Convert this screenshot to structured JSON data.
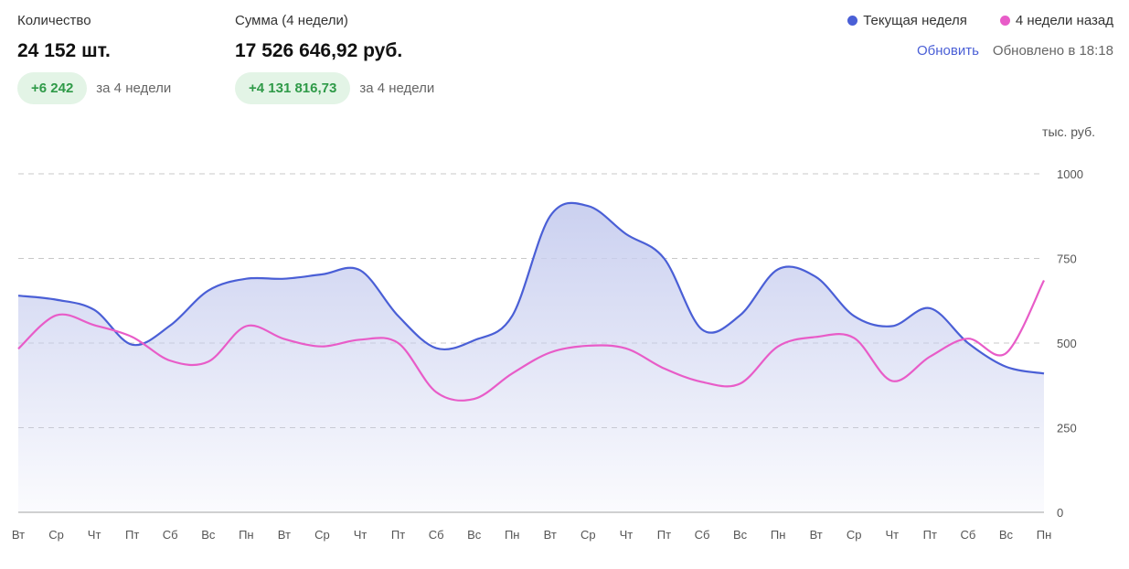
{
  "stats": {
    "quantity": {
      "label": "Количество",
      "value": "24 152 шт.",
      "delta": "+6 242",
      "period": "за 4 недели"
    },
    "sum": {
      "label": "Сумма (4 недели)",
      "value": "17 526 646,92 руб.",
      "delta": "+4 131 816,73",
      "period": "за 4 недели"
    }
  },
  "legend": {
    "current": "Текущая неделя",
    "previous": "4 недели назад"
  },
  "refresh": {
    "label": "Обновить",
    "updated": "Обновлено в 18:18"
  },
  "colors": {
    "current": "#4a5fd6",
    "previous": "#e85cc8",
    "badge_bg": "#e3f4e6",
    "badge_text": "#2f9a48",
    "grid": "#c8c8c8"
  },
  "chart_data": {
    "type": "area",
    "unit_label": "тыс. руб.",
    "ylim": [
      0,
      1000
    ],
    "y_ticks": [
      1000,
      750,
      500,
      250,
      0
    ],
    "categories": [
      "Вт",
      "Ср",
      "Чт",
      "Пт",
      "Сб",
      "Вс",
      "Пн",
      "Вт",
      "Ср",
      "Чт",
      "Пт",
      "Сб",
      "Вс",
      "Пн",
      "Вт",
      "Ср",
      "Чт",
      "Пт",
      "Сб",
      "Вс",
      "Пн",
      "Вт",
      "Ср",
      "Чт",
      "Пт",
      "Сб",
      "Вс",
      "Пн"
    ],
    "grid": true,
    "legend_position": "top-right",
    "series": [
      {
        "name": "Текущая неделя",
        "values": [
          640,
          628,
          598,
          495,
          552,
          655,
          690,
          690,
          703,
          715,
          580,
          485,
          508,
          580,
          875,
          905,
          822,
          750,
          540,
          582,
          718,
          695,
          580,
          550,
          603,
          500,
          430,
          410
        ]
      },
      {
        "name": "4 недели назад",
        "values": [
          483,
          582,
          553,
          518,
          448,
          445,
          550,
          512,
          490,
          510,
          500,
          355,
          335,
          410,
          472,
          492,
          484,
          425,
          385,
          380,
          490,
          518,
          515,
          388,
          460,
          513,
          470,
          685
        ]
      }
    ]
  }
}
